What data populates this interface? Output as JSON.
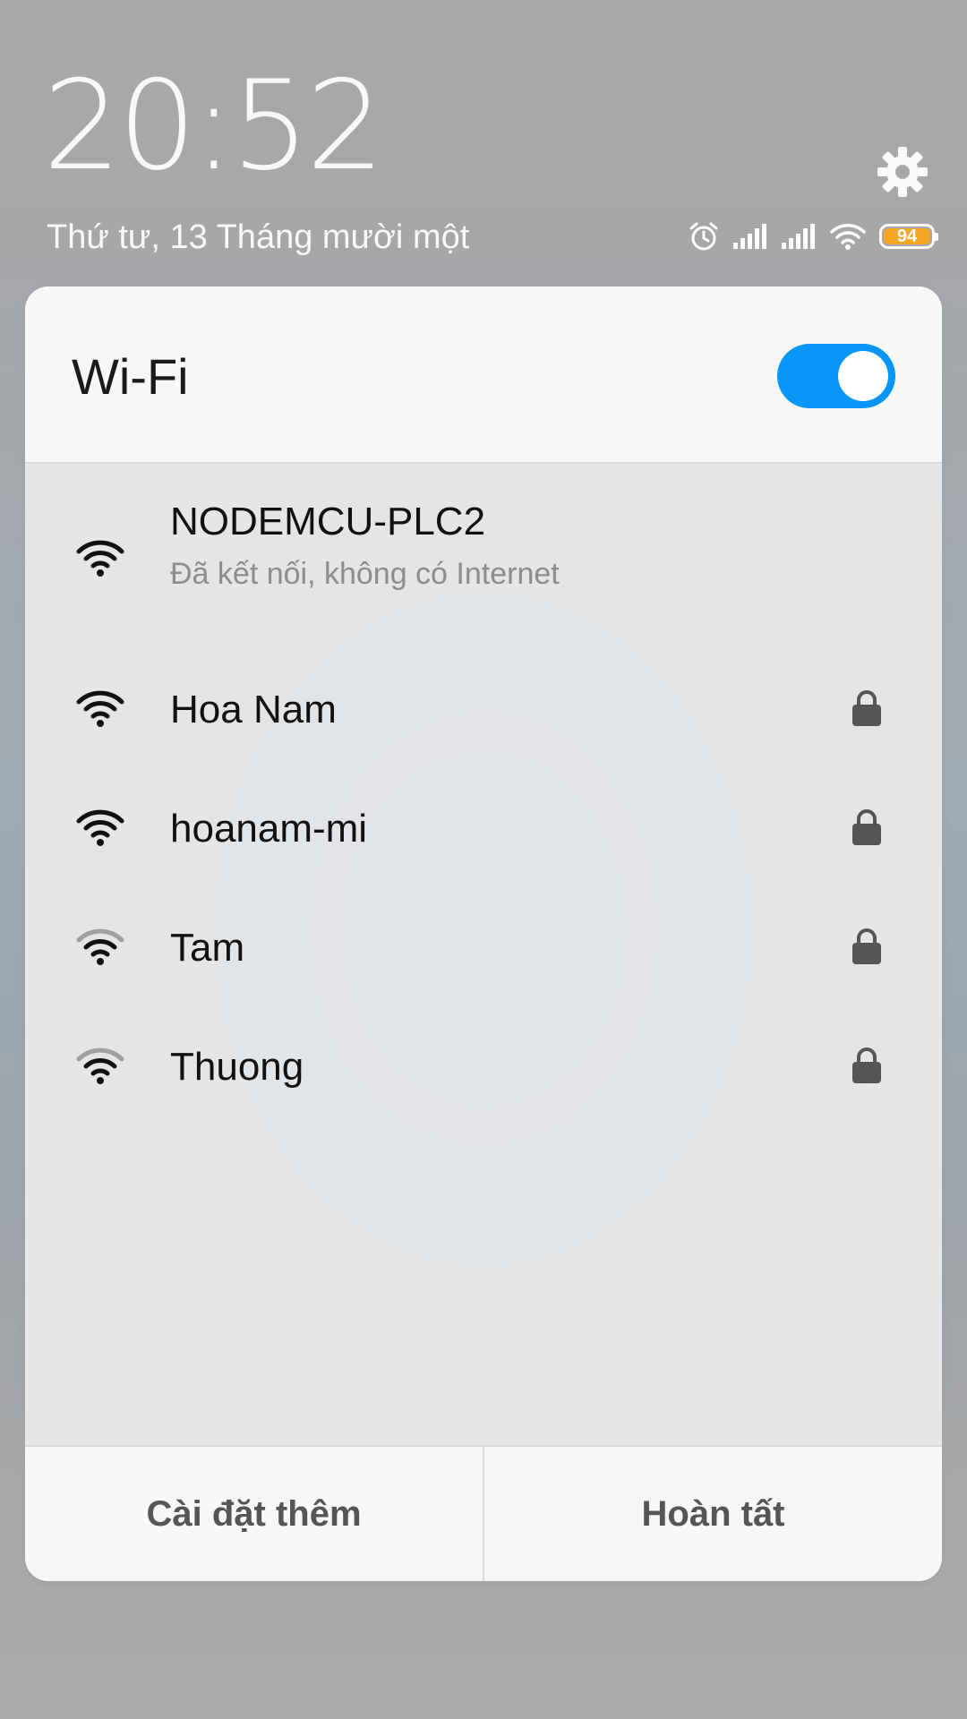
{
  "header": {
    "time": "20:52",
    "date": "Thứ tư, 13 Tháng mười một",
    "battery_level": "94",
    "settings_icon": "gear-icon"
  },
  "status_bar": {
    "icons": [
      "alarm-icon",
      "signal-icon",
      "signal-icon",
      "wifi-icon",
      "battery-icon"
    ]
  },
  "wifi_panel": {
    "title": "Wi-Fi",
    "enabled": true,
    "networks": [
      {
        "name": "NODEMCU-PLC2",
        "status": "Đã kết nối, không có Internet",
        "signal": "full",
        "locked": false
      },
      {
        "name": "Hoa Nam",
        "signal": "full",
        "locked": true
      },
      {
        "name": "hoanam-mi",
        "signal": "full",
        "locked": true
      },
      {
        "name": "Tam",
        "signal": "medium",
        "locked": true
      },
      {
        "name": "Thuong",
        "signal": "medium",
        "locked": true
      }
    ],
    "more_settings_label": "Cài đặt thêm",
    "done_label": "Hoàn tất"
  },
  "colors": {
    "accent": "#0895f8",
    "battery": "#f5a623",
    "panel_bg": "#f6f7f7"
  }
}
